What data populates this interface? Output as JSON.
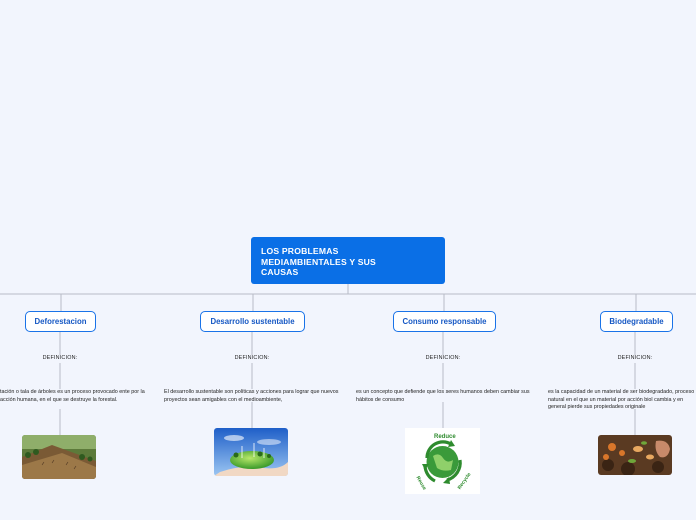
{
  "root": {
    "title_line1": "LOS PROBLEMAS",
    "title_line2": "MEDIAMBIENTALES Y SUS",
    "title_line3": "CAUSAS"
  },
  "branches": [
    {
      "label": "Deforestacion",
      "subheading": "DEFINICION:",
      "description": "tación o tala de árboles es un proceso provocado ente por la acción humana, en el que se destruye la forestal.",
      "image": "deforested-hillside-photo"
    },
    {
      "label": "Desarrollo sustentable",
      "subheading": "DEFINICION:",
      "description": "El desarrollo sustentable son políticas y acciones para lograr que nuevos proyectos sean amigables con el medioambiente,",
      "image": "green-globe-in-hand-photo"
    },
    {
      "label": "Consumo responsable",
      "subheading": "DEFINICION:",
      "description": "es un concepto que defiende que los seres humanos deben cambiar sus hábitos de consumo",
      "image": "recycle-earth-logo",
      "image_words": [
        "Reduce",
        "Reuse",
        "Recycle"
      ]
    },
    {
      "label": "Biodegradable",
      "subheading": "DEFINICION:",
      "description": "es la capacidad de un material de ser biodegradado, proceso natural en el que un material por acción biol cambia y en general pierde sus propiedades originale",
      "image": "compost-soil-photo"
    }
  ],
  "colors": {
    "background": "#f2f5fd",
    "root_fill": "#0a6fe6",
    "topic_border": "#1a73e8",
    "topic_text": "#1658c4",
    "connector": "#b8bcc6"
  }
}
